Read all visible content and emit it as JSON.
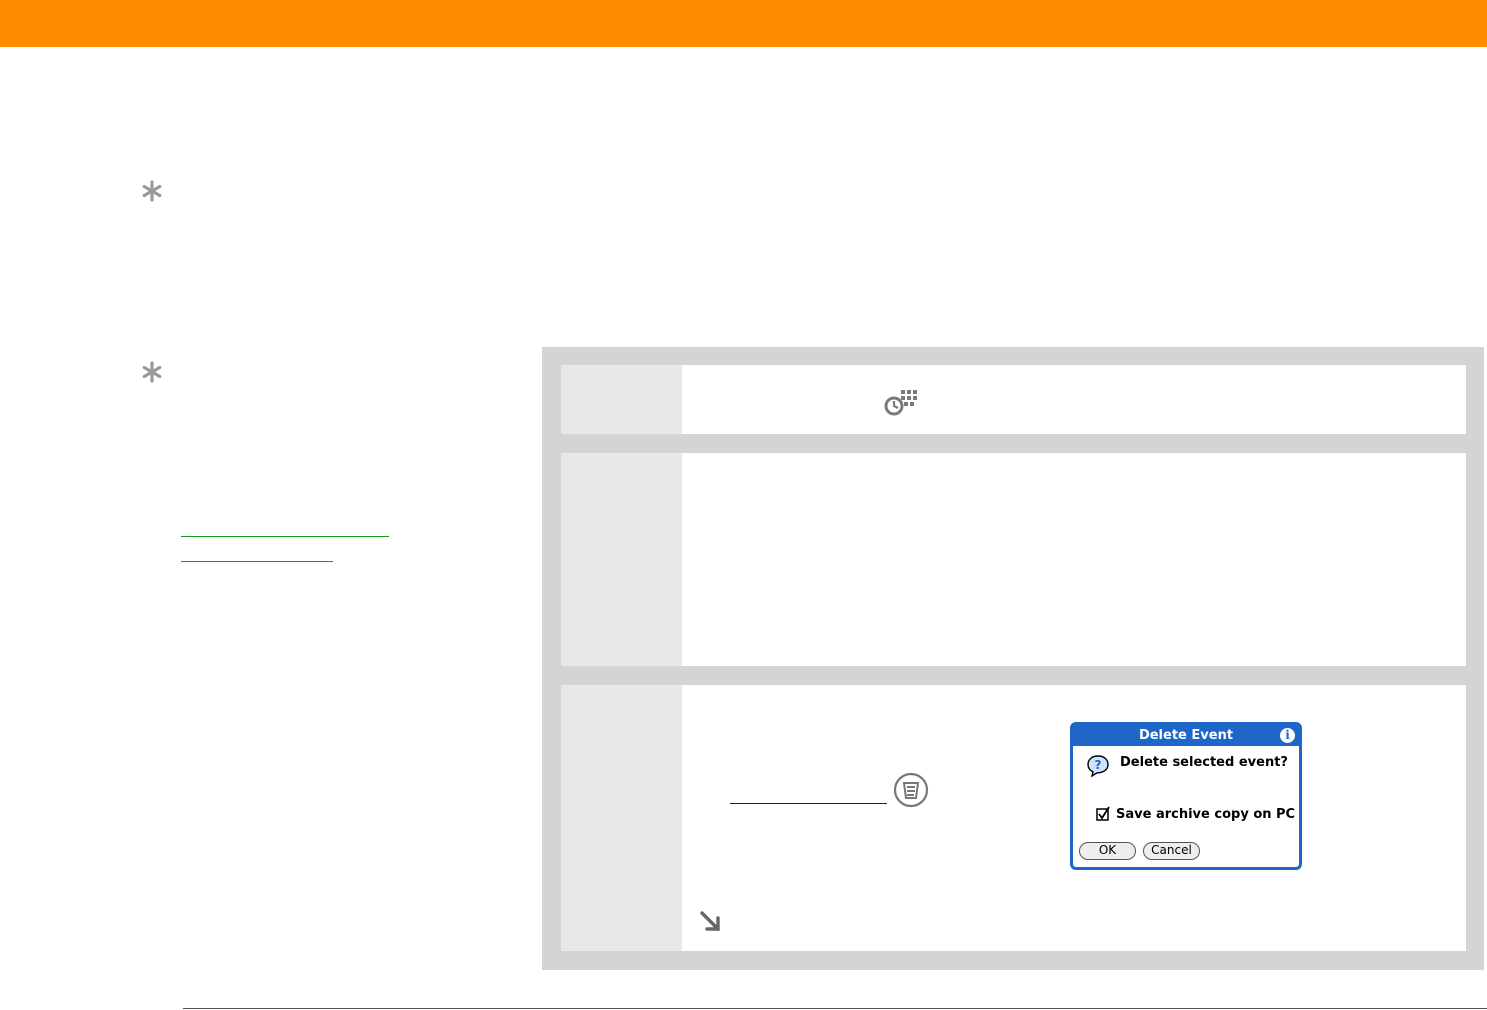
{
  "colors": {
    "accent": "#ff8c00",
    "link": "#1a9a1a",
    "dialog_blue": "#1e66c8",
    "panel_gray": "#d4d4d4"
  },
  "icons": {
    "tip": "asterisk-icon",
    "app": "calendar-clock-icon",
    "menu": "menu-icon",
    "continue": "arrow-down-right-icon",
    "dialog_info": "info-icon",
    "dialog_question": "question-icon"
  },
  "dialog": {
    "title": "Delete Event",
    "info_glyph": "i",
    "message": "Delete selected event?",
    "checkbox_label": "Save archive copy on PC",
    "checkbox_checked": true,
    "ok_label": "OK",
    "cancel_label": "Cancel"
  }
}
